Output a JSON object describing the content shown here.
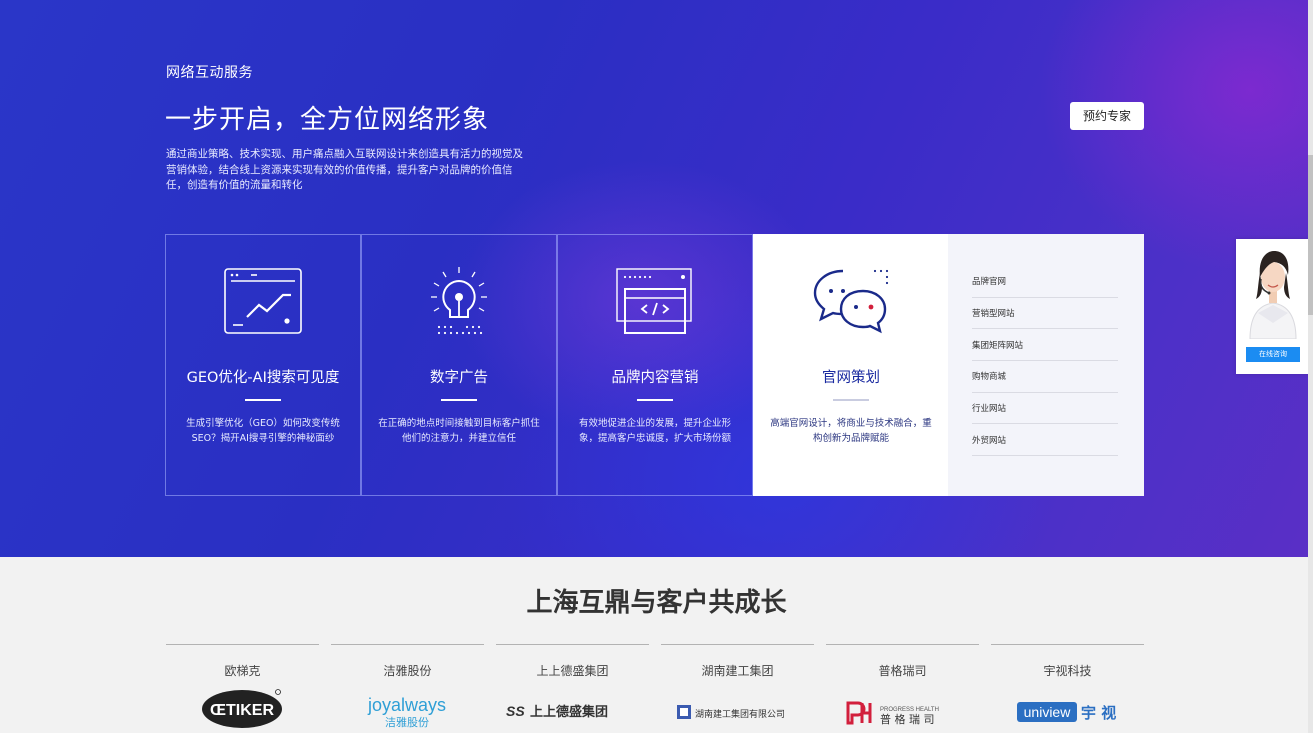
{
  "hero": {
    "eyebrow": "网络互动服务",
    "title": "一步开启，全方位网络形象",
    "description": "通过商业策略、技术实现、用户痛点融入互联网设计来创造具有活力的视觉及营销体验，结合线上资源来实现有效的价值传播，提升客户对品牌的价值信任，创造有价值的流量和转化",
    "cta_label": "预约专家"
  },
  "cards": [
    {
      "icon": "chart-window-icon",
      "title": "GEO优化-AI搜索可见度",
      "text": "生成引擎优化（GEO）如何改变传统SEO？揭开AI搜寻引擎的神秘面纱"
    },
    {
      "icon": "lightbulb-icon",
      "title": "数字广告",
      "text": "在正确的地点时间接触到目标客户抓住他们的注意力，并建立信任"
    },
    {
      "icon": "code-window-icon",
      "title": "品牌内容营销",
      "text": "有效地促进企业的发展，提升企业形象，提高客户忠诚度，扩大市场份额"
    },
    {
      "icon": "chat-bubbles-icon",
      "title": "官网策划",
      "text": "高端官网设计，将商业与技术融合，重构创新为品牌赋能"
    }
  ],
  "sublist": [
    "品牌官网",
    "营销型网站",
    "集团矩阵网站",
    "购物商城",
    "行业网站",
    "外贸网站"
  ],
  "float_chat": {
    "button_label": "在线咨询"
  },
  "clients": {
    "title": "上海互鼎与客户共成长",
    "items": [
      {
        "name": "欧梯克",
        "logo_text": "ŒTIKER"
      },
      {
        "name": "洁雅股份",
        "logo_text": "joyalways",
        "logo_sub": "洁雅股份"
      },
      {
        "name": "上上德盛集团",
        "logo_text": "上上德盛集团",
        "logo_prefix": "SS"
      },
      {
        "name": "湖南建工集团",
        "logo_text": "湖南建工集团有限公司"
      },
      {
        "name": "普格瑞司",
        "logo_text": "普 格 瑞 司",
        "logo_sub": "PROGRESS HEALTH"
      },
      {
        "name": "宇视科技",
        "logo_text": "uniview",
        "logo_sub": "宇 视"
      }
    ]
  },
  "colors": {
    "accent_blue": "#1b8cf2",
    "hero_blue": "#2a36c8",
    "active_title": "#1a2aa0",
    "brand_red": "#d21f3c"
  }
}
